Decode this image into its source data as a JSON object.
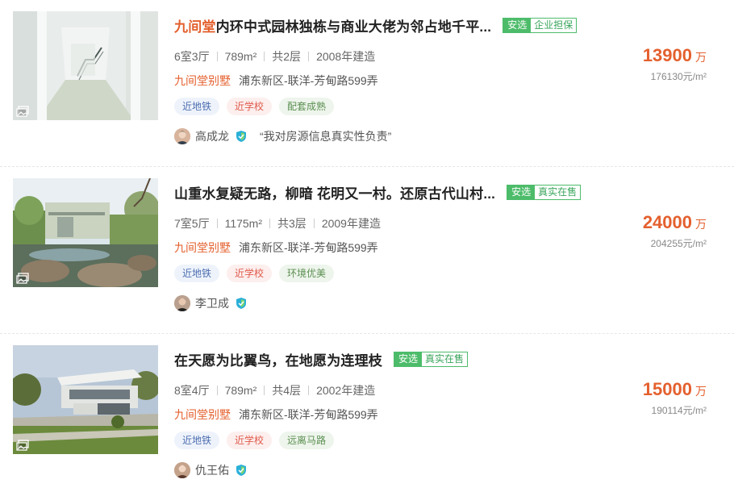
{
  "listings": [
    {
      "title_brand": "九间堂",
      "title_rest": "内环中式园林独栋与商业大佬为邻占地千平...",
      "badge_select": "安选",
      "badge_extra": "企业担保",
      "layout": "6室3厅",
      "area": "789m²",
      "floors": "共2层",
      "built": "2008年建造",
      "community": "九间堂别墅",
      "address": "浦东新区-联洋-芳甸路599弄",
      "tags": [
        "近地铁",
        "近学校",
        "配套成熟"
      ],
      "agent": "高成龙",
      "agent_quote": "“我对房源信息真实性负责”",
      "price": "13900",
      "price_unit": "万",
      "unit_price": "176130元/m²",
      "image_icon": "image-gallery-icon"
    },
    {
      "title_brand": "",
      "title_rest": "山重水复疑无路，柳暗 花明又一村。还原古代山村...",
      "badge_select": "安选",
      "badge_extra": "真实在售",
      "layout": "7室5厅",
      "area": "1175m²",
      "floors": "共3层",
      "built": "2009年建造",
      "community": "九间堂别墅",
      "address": "浦东新区-联洋-芳甸路599弄",
      "tags": [
        "近地铁",
        "近学校",
        "环境优美"
      ],
      "agent": "李卫成",
      "agent_quote": "",
      "price": "24000",
      "price_unit": "万",
      "unit_price": "204255元/m²",
      "image_icon": "image-gallery-icon"
    },
    {
      "title_brand": "",
      "title_rest": "在天愿为比翼鸟，在地愿为连理枝",
      "badge_select": "安选",
      "badge_extra": "真实在售",
      "layout": "8室4厅",
      "area": "789m²",
      "floors": "共4层",
      "built": "2002年建造",
      "community": "九间堂别墅",
      "address": "浦东新区-联洋-芳甸路599弄",
      "tags": [
        "近地铁",
        "近学校",
        "远离马路"
      ],
      "agent": "仇王佑",
      "agent_quote": "",
      "price": "15000",
      "price_unit": "万",
      "unit_price": "190114元/m²",
      "image_icon": "image-gallery-icon"
    }
  ],
  "colors": {
    "brand_orange": "#e4602e",
    "badge_green": "#4dbc6a",
    "verified_shield": "#2ab0d8"
  }
}
